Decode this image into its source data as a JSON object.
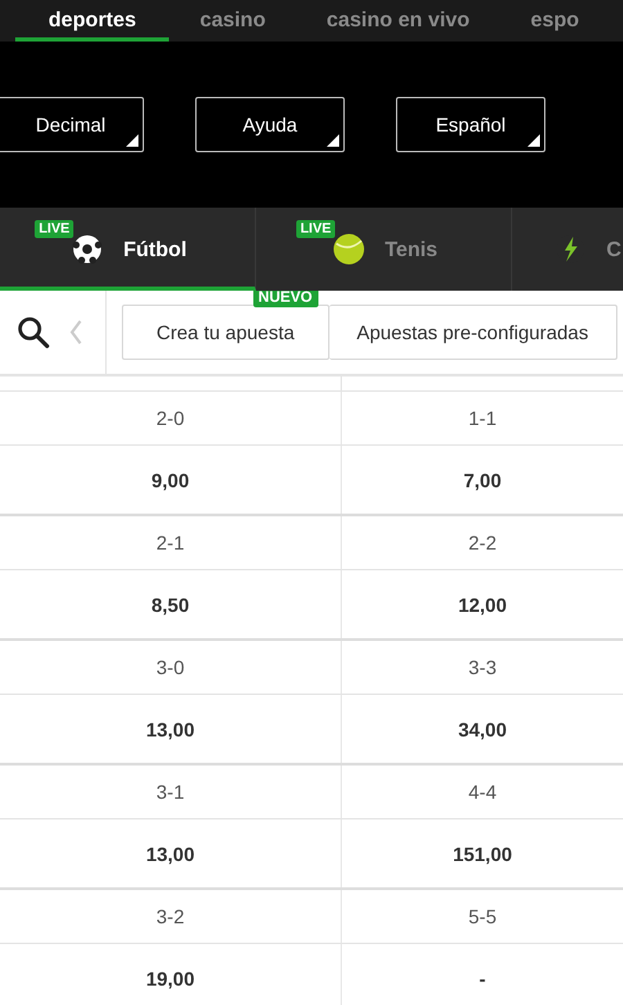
{
  "top_nav": [
    {
      "label": "deportes",
      "selected": true
    },
    {
      "label": "casino",
      "selected": false
    },
    {
      "label": "casino en vivo",
      "selected": false
    },
    {
      "label": "espo",
      "selected": false
    }
  ],
  "settings_buttons": [
    "Decimal",
    "Ayuda",
    "Español"
  ],
  "sport_tabs": [
    {
      "label": "Fútbol",
      "kind": "football",
      "live_badge": "LIVE",
      "selected": true
    },
    {
      "label": "Tenis",
      "kind": "tennis",
      "live_badge": "LIVE",
      "selected": false
    },
    {
      "label": "C",
      "kind": "esports",
      "selected": false
    }
  ],
  "market_tabs": [
    {
      "label": "Crea tu apuesta",
      "badge": "NUEVO"
    },
    {
      "label": "Apuestas pre-configuradas"
    }
  ],
  "scores": [
    {
      "left": {
        "score": "2-0",
        "odds": "9,00"
      },
      "right": {
        "score": "1-1",
        "odds": "7,00"
      }
    },
    {
      "left": {
        "score": "2-1",
        "odds": "8,50"
      },
      "right": {
        "score": "2-2",
        "odds": "12,00"
      }
    },
    {
      "left": {
        "score": "3-0",
        "odds": "13,00"
      },
      "right": {
        "score": "3-3",
        "odds": "34,00"
      }
    },
    {
      "left": {
        "score": "3-1",
        "odds": "13,00"
      },
      "right": {
        "score": "4-4",
        "odds": "151,00"
      }
    },
    {
      "left": {
        "score": "3-2",
        "odds": "19,00"
      },
      "right": {
        "score": "5-5",
        "odds": "-"
      }
    }
  ]
}
